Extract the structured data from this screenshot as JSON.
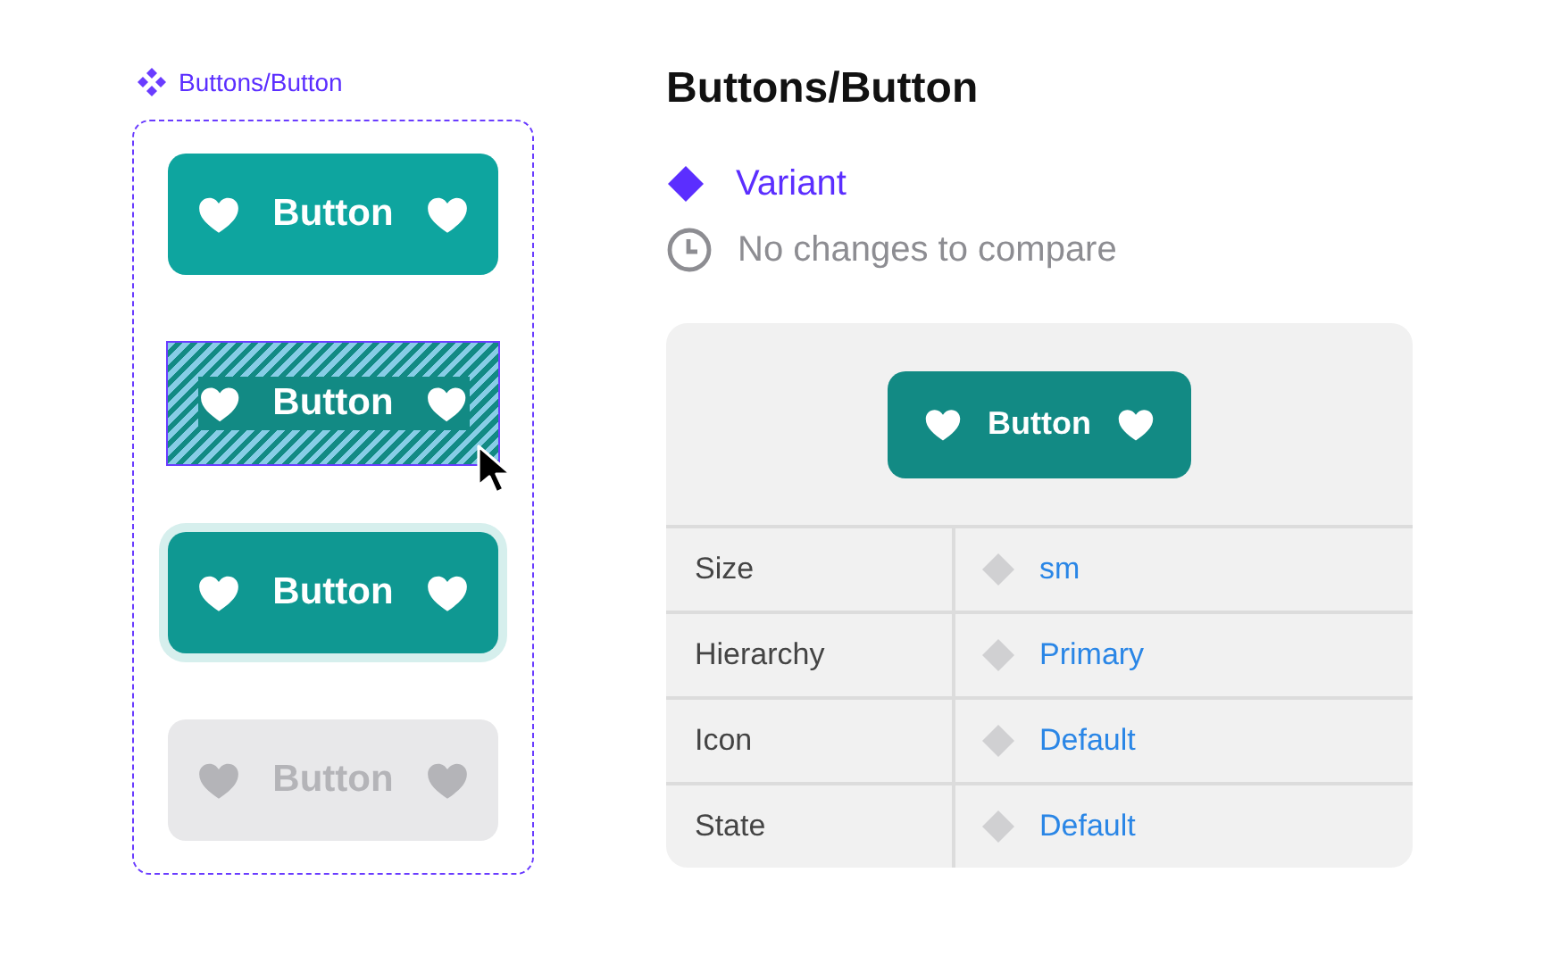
{
  "component_set": {
    "label": "Buttons/Button",
    "variants": [
      {
        "kind": "default",
        "label": "Button",
        "selected": false
      },
      {
        "kind": "hover",
        "label": "Button",
        "selected": true
      },
      {
        "kind": "focused",
        "label": "Button",
        "selected": false
      },
      {
        "kind": "disabled",
        "label": "Button",
        "selected": false
      }
    ]
  },
  "inspector": {
    "title": "Buttons/Button",
    "variant_label": "Variant",
    "history_note": "No changes to compare",
    "preview": {
      "label": "Button"
    },
    "properties": [
      {
        "name": "Size",
        "value": "sm"
      },
      {
        "name": "Hierarchy",
        "value": "Primary"
      },
      {
        "name": "Icon",
        "value": "Default"
      },
      {
        "name": "State",
        "value": "Default"
      }
    ]
  }
}
